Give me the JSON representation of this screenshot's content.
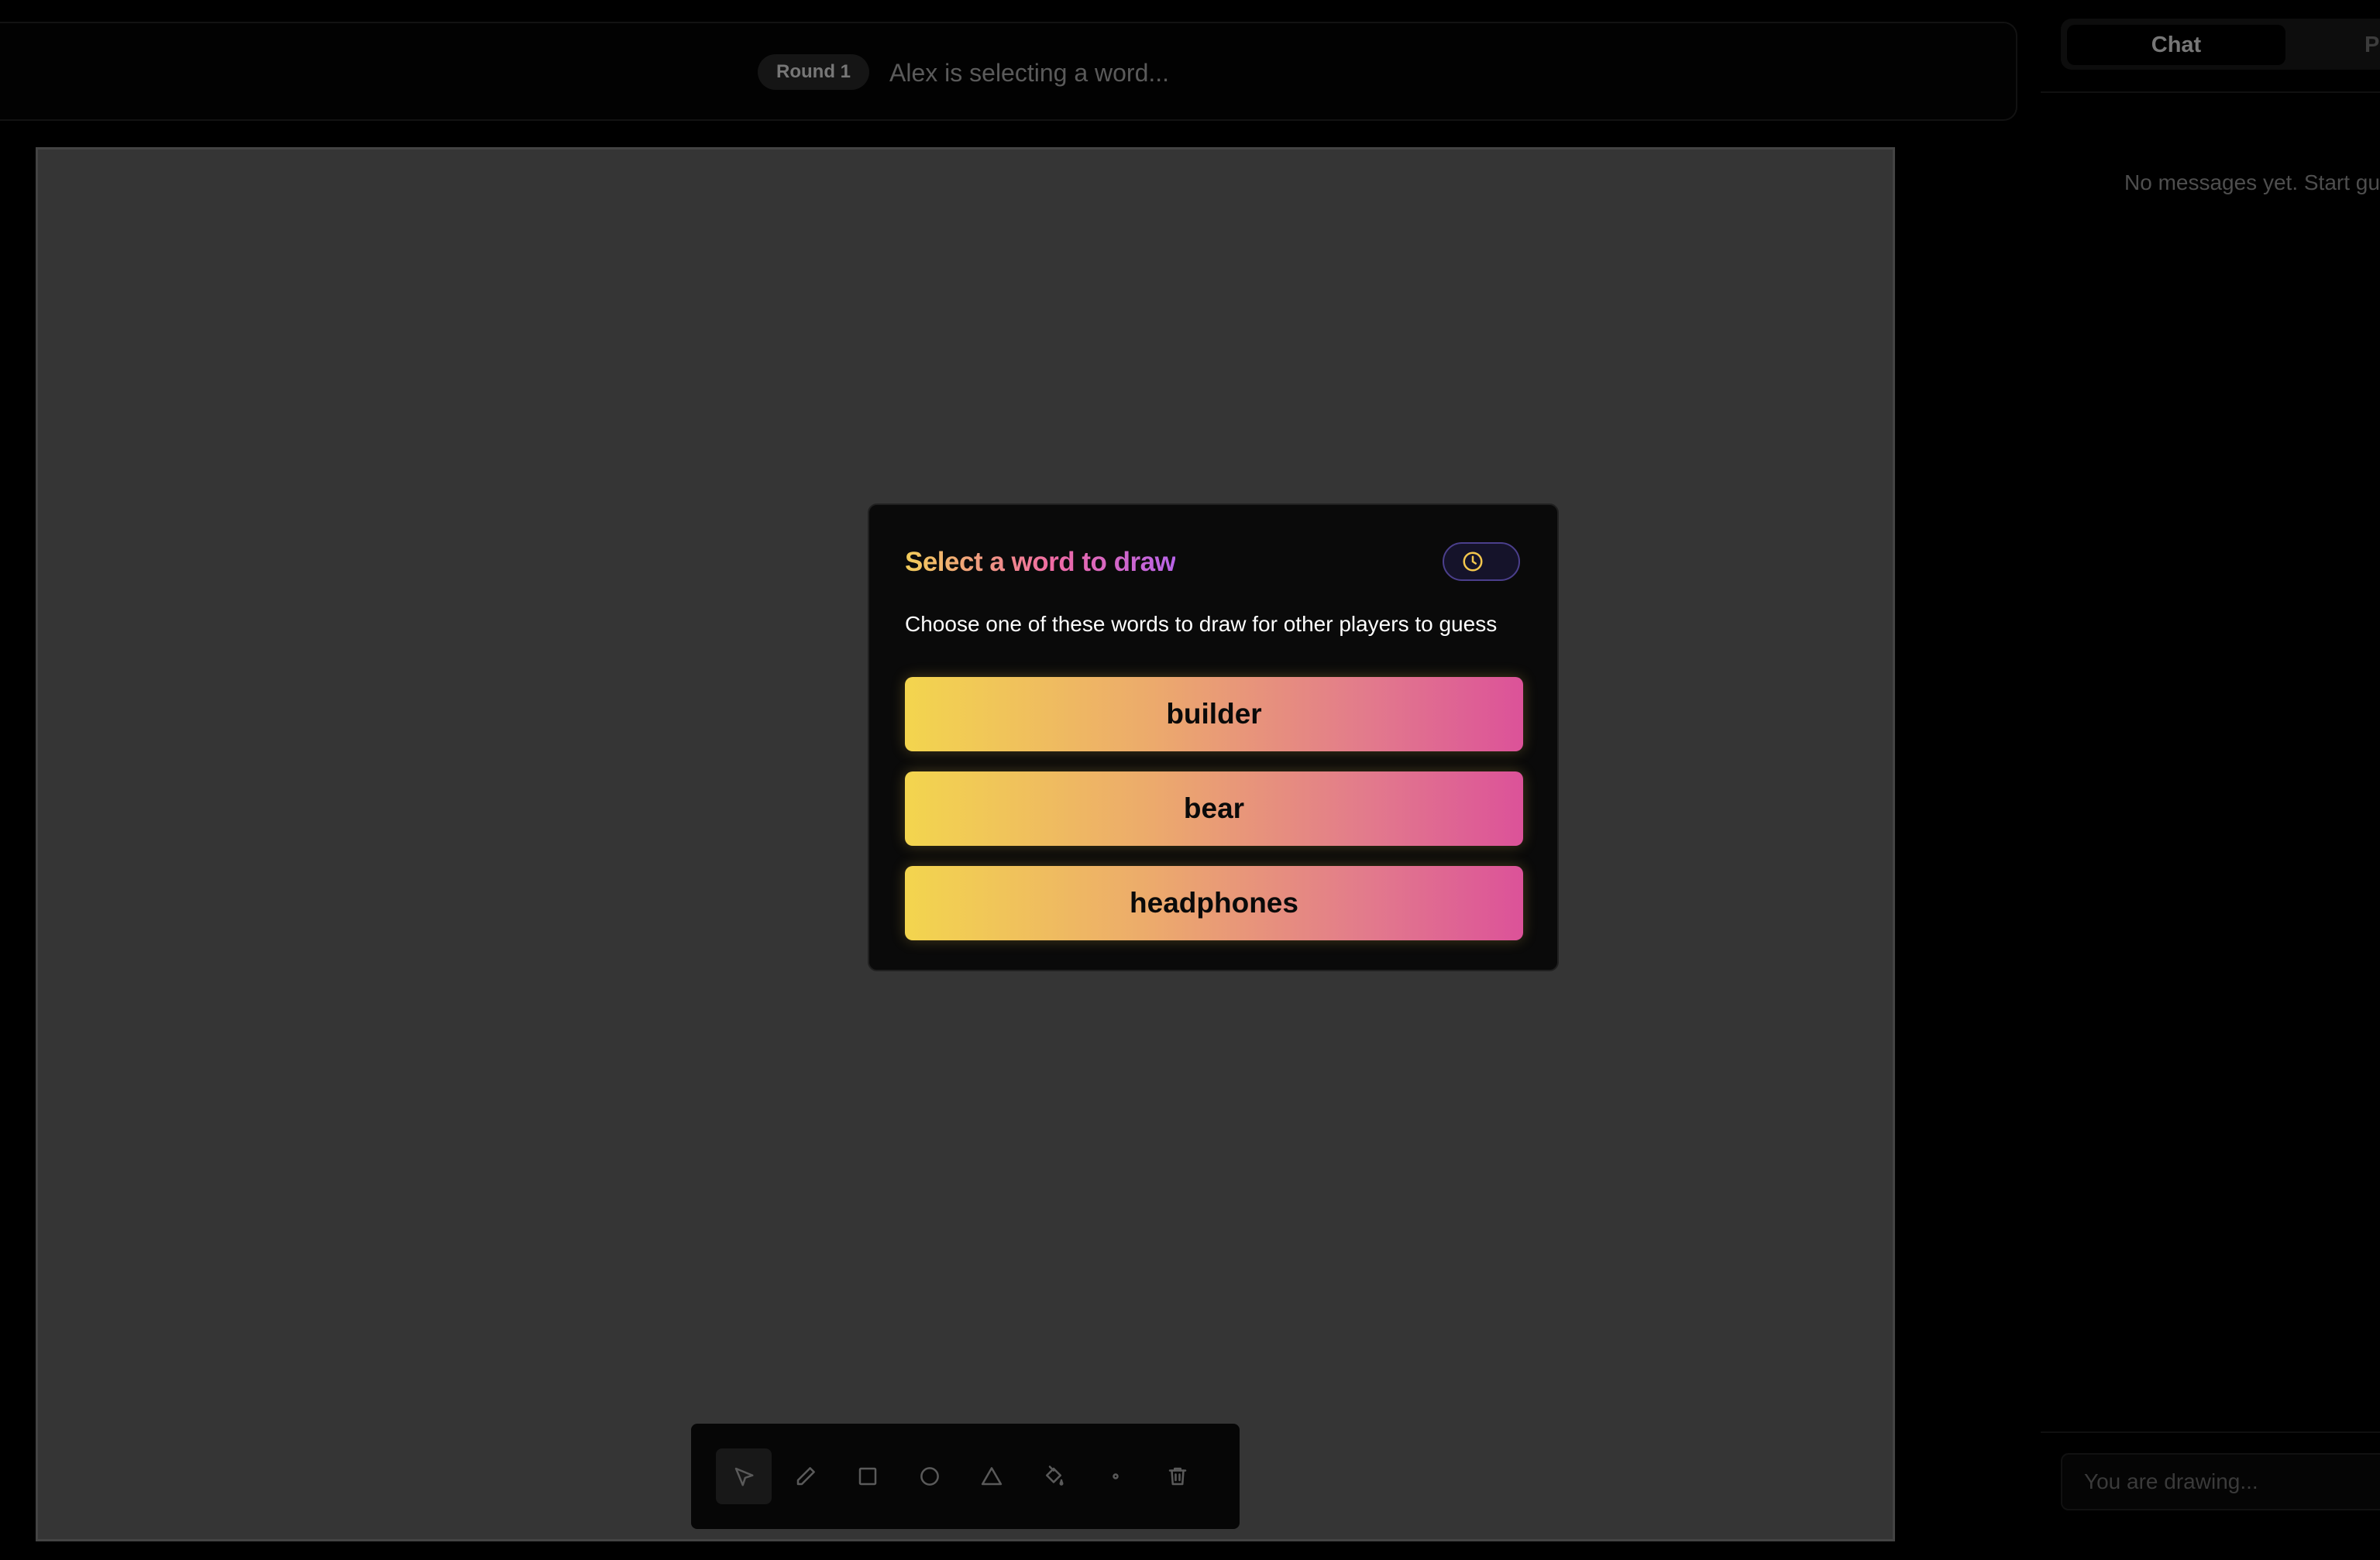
{
  "header": {
    "round_label": "Round 1",
    "status": "Alex is selecting a word..."
  },
  "sidebar": {
    "tabs": [
      {
        "label": "Chat",
        "active": true
      },
      {
        "label": "P",
        "active": false
      }
    ],
    "empty_message": "No messages yet. Start gu",
    "input_placeholder": "You are drawing..."
  },
  "modal": {
    "title": "Select a word to draw",
    "timer_icon": "clock-icon",
    "description": "Choose one of these words to draw for other players to guess",
    "words": [
      "builder",
      "bear",
      "headphones"
    ]
  },
  "toolbar": {
    "tools": [
      {
        "icon": "select-cursor-icon",
        "active": true
      },
      {
        "icon": "pencil-icon",
        "active": false
      },
      {
        "icon": "rectangle-icon",
        "active": false
      },
      {
        "icon": "circle-icon",
        "active": false
      },
      {
        "icon": "triangle-icon",
        "active": false
      },
      {
        "icon": "paint-bucket-icon",
        "active": false
      },
      {
        "icon": "brush-size-dot-icon",
        "active": false
      },
      {
        "icon": "trash-icon",
        "active": false
      }
    ]
  },
  "colors": {
    "background": "#000000",
    "canvas": "#353535",
    "accent_gradient_start": "#f3d54e",
    "accent_gradient_end": "#dc5299",
    "timer_icon": "#f3c64d"
  }
}
